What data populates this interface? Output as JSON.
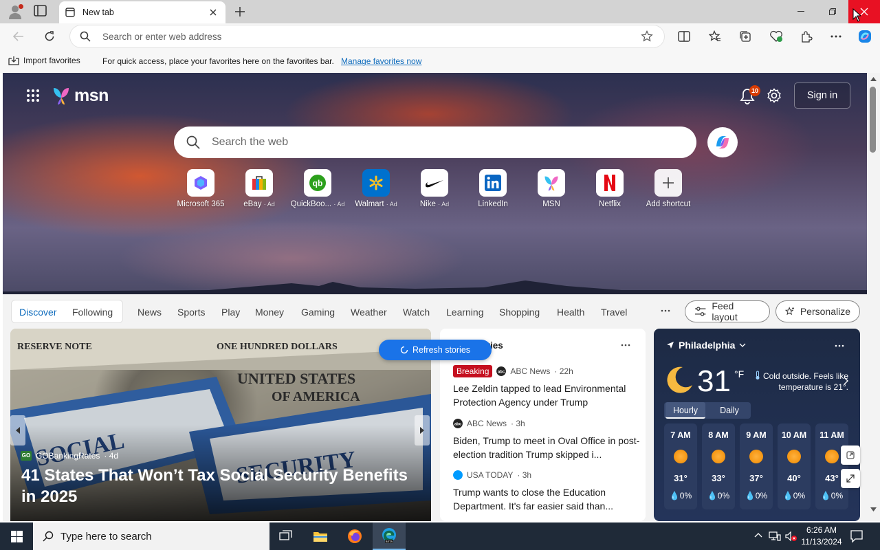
{
  "browser": {
    "tab_title": "New tab",
    "address_placeholder": "Search or enter web address"
  },
  "favorites_bar": {
    "import_label": "Import favorites",
    "message": "For quick access, place your favorites here on the favorites bar.",
    "manage_link": "Manage favorites now"
  },
  "msn": {
    "logo_text": "msn",
    "notification_count": "10",
    "sign_in": "Sign in",
    "search_placeholder": "Search the web",
    "shortcuts": [
      {
        "label": "Microsoft 365",
        "ad": ""
      },
      {
        "label": "eBay",
        "ad": "· Ad"
      },
      {
        "label": "QuickBoo...",
        "ad": "· Ad"
      },
      {
        "label": "Walmart",
        "ad": "· Ad"
      },
      {
        "label": "Nike",
        "ad": "· Ad"
      },
      {
        "label": "LinkedIn",
        "ad": ""
      },
      {
        "label": "MSN",
        "ad": ""
      },
      {
        "label": "Netflix",
        "ad": ""
      },
      {
        "label": "Add shortcut",
        "ad": ""
      }
    ]
  },
  "nav": {
    "discover": "Discover",
    "following": "Following",
    "items": [
      "News",
      "Sports",
      "Play",
      "Money",
      "Gaming",
      "Weather",
      "Watch",
      "Learning",
      "Shopping",
      "Health",
      "Travel"
    ],
    "feed_layout": "Feed layout",
    "personalize": "Personalize"
  },
  "hero_story": {
    "source": "GOBankingRates",
    "source_badge": "GO",
    "age": "· 4d",
    "headline": "41 States That Won’t Tax Social Security Benefits in 2025"
  },
  "refresh_label": "Refresh stories",
  "top_stories": {
    "title": "Top stories",
    "items": [
      {
        "badge": "Breaking",
        "source": "ABC News",
        "age": "· 22h",
        "headline": "Lee Zeldin tapped to lead Environmental Protection Agency under Trump"
      },
      {
        "badge": "",
        "source": "ABC News",
        "age": "· 3h",
        "headline": "Biden, Trump to meet in Oval Office in post-election tradition Trump skipped i..."
      },
      {
        "badge": "",
        "source": "USA TODAY",
        "age": "· 3h",
        "headline": "Trump wants to close the Education Department. It's far easier said than..."
      }
    ]
  },
  "weather": {
    "location": "Philadelphia",
    "temp": "31",
    "unit": "°F",
    "condition": "Cold outside. Feels like temperature is 21°.",
    "tabs": [
      "Hourly",
      "Daily"
    ],
    "hours": [
      {
        "time": "7 AM",
        "temp": "31°",
        "precip": "0%"
      },
      {
        "time": "8 AM",
        "temp": "33°",
        "precip": "0%"
      },
      {
        "time": "9 AM",
        "temp": "37°",
        "precip": "0%"
      },
      {
        "time": "10 AM",
        "temp": "40°",
        "precip": "0%"
      },
      {
        "time": "11 AM",
        "temp": "43°",
        "precip": "0%"
      }
    ]
  },
  "taskbar": {
    "search_placeholder": "Type here to search",
    "time": "6:26 AM",
    "date": "11/13/2024"
  },
  "colors": {
    "accent": "#0f6cbd",
    "close_red": "#e81123",
    "breaking": "#c50f1f",
    "refresh": "#1a73e8"
  }
}
